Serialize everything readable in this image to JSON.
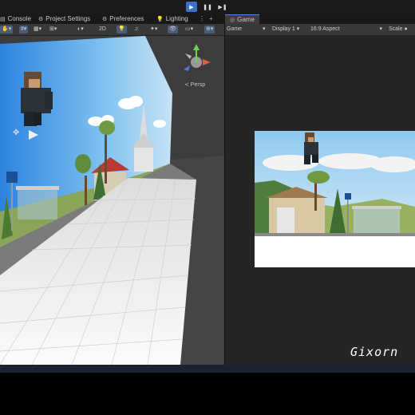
{
  "playbar": {
    "play_icon": "play-icon",
    "pause_icon": "pause-icon",
    "step_icon": "step-icon",
    "play": "▶",
    "pause": "❚❚",
    "step": "▶❚"
  },
  "tabs": {
    "console": "Console",
    "project_settings": "Project Settings",
    "preferences": "Preferences",
    "lighting": "Lighting",
    "game": "Game"
  },
  "scene_toolbar": {
    "mode_2d": "2D",
    "persp_label": "≺ Persp"
  },
  "game_toolbar": {
    "view": "Game",
    "display": "Display 1",
    "aspect": "16:9 Aspect",
    "scale": "Scale"
  },
  "watermark": "Gixorn",
  "colors": {
    "accent": "#3a72c7",
    "sky": "#8ec6ef",
    "ground": "#f4f4f4"
  }
}
